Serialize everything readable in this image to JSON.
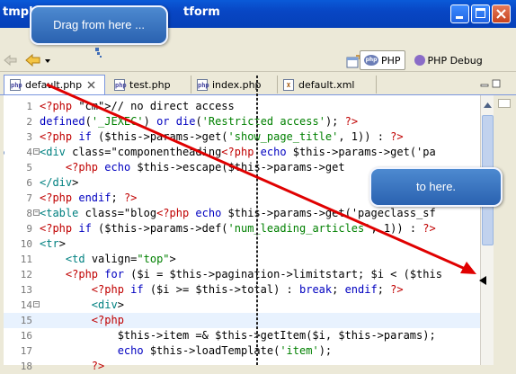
{
  "window": {
    "title_left": "tmpl/",
    "title_right": "tform"
  },
  "perspectives": [
    {
      "label": "PHP",
      "active": true
    },
    {
      "label": "PHP Debug",
      "active": false
    }
  ],
  "tabs": [
    {
      "label": "default.php",
      "active": true,
      "icon": "php-file-icon"
    },
    {
      "label": "test.php",
      "active": false,
      "icon": "php-file-icon"
    },
    {
      "label": "index.php",
      "active": false,
      "icon": "php-file-icon"
    },
    {
      "label": "default.xml",
      "active": false,
      "icon": "xml-file-icon"
    }
  ],
  "code_lines": [
    {
      "n": "1",
      "text": "<?php // no direct access"
    },
    {
      "n": "2",
      "text": "defined('_JEXEC') or die('Restricted access'); ?>"
    },
    {
      "n": "3",
      "text": "<?php if ($this->params->get('show_page_title', 1)) : ?>"
    },
    {
      "n": "4",
      "text": "<div class=\"componentheading<?php echo $this->params->get('pa"
    },
    {
      "n": "5",
      "text": "    <?php echo $this->escape($this->params->get"
    },
    {
      "n": "6",
      "text": "</div>"
    },
    {
      "n": "7",
      "text": "<?php endif; ?>"
    },
    {
      "n": "8",
      "text": "<table class=\"blog<?php echo $this->params->get('pageclass_sf"
    },
    {
      "n": "9",
      "text": "<?php if ($this->params->def('num_leading_articles', 1)) : ?>"
    },
    {
      "n": "10",
      "text": "<tr>"
    },
    {
      "n": "11",
      "text": "    <td valign=\"top\">"
    },
    {
      "n": "12",
      "text": "    <?php for ($i = $this->pagination->limitstart; $i < ($this"
    },
    {
      "n": "13",
      "text": "        <?php if ($i >= $this->total) : break; endif; ?>"
    },
    {
      "n": "14",
      "text": "        <div>"
    },
    {
      "n": "15",
      "text": "        <?php"
    },
    {
      "n": "16",
      "text": "            $this->item =& $this->getItem($i, $this->params);"
    },
    {
      "n": "17",
      "text": "            echo $this->loadTemplate('item');"
    },
    {
      "n": "18",
      "text": "        ?>"
    }
  ],
  "callouts": {
    "drag_from": "Drag from here ...",
    "drag_to": "to here."
  },
  "colors": {
    "arrow": "#e00000",
    "callout": "#3a74c4",
    "title_bar": "#0a54d4"
  }
}
